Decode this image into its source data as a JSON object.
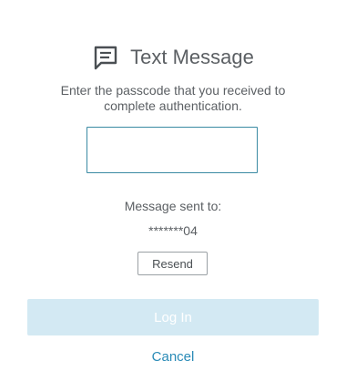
{
  "header": {
    "icon": "message-icon",
    "title": "Text Message"
  },
  "instruction": "Enter the passcode that you received to complete authentication.",
  "passcode": {
    "value": "",
    "placeholder": ""
  },
  "sent": {
    "label": "Message sent to:",
    "number": "*******04"
  },
  "buttons": {
    "resend_label": "Resend",
    "login_label": "Log In",
    "cancel_label": "Cancel"
  },
  "colors": {
    "input_border": "#3a8aa3",
    "login_disabled_bg": "#d3e9f3",
    "link": "#2a8bb7",
    "text": "#5b5f63"
  }
}
